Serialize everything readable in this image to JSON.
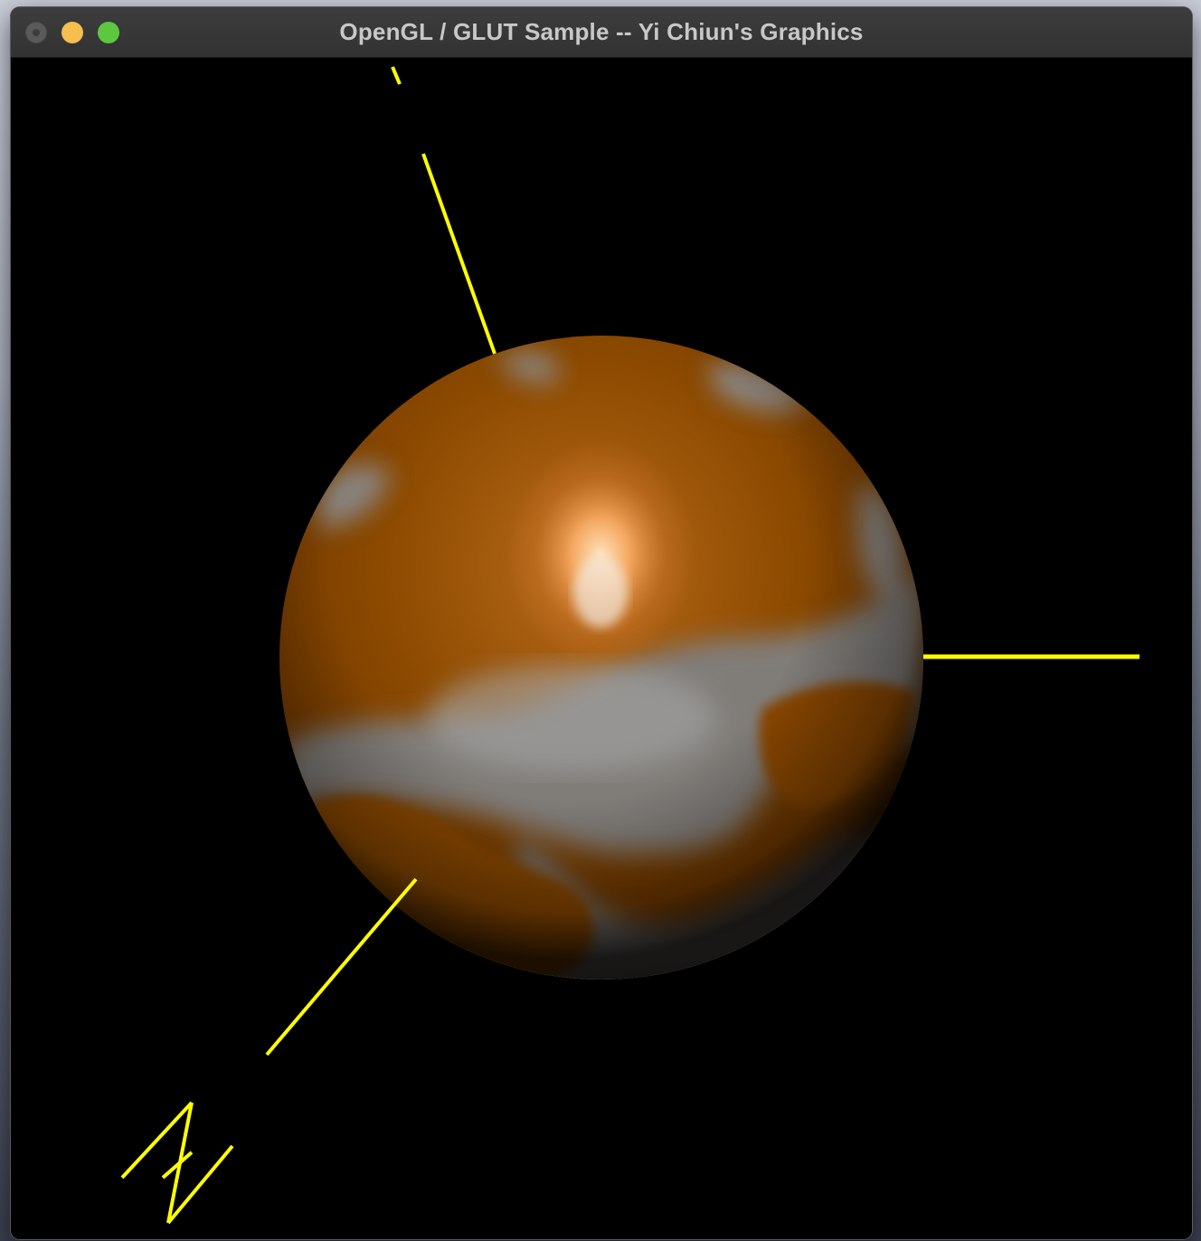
{
  "window": {
    "title": "OpenGL / GLUT Sample -- Yi Chiun's Graphics"
  },
  "controls": {
    "close": "close-icon",
    "minimize": "minimize-icon",
    "zoom": "zoom-icon"
  },
  "scene": {
    "axis_color": "#ffff00",
    "sphere_base_color": "#8c4a00",
    "sphere_highlight_color": "#ffc88a",
    "sphere_secondary_color": "#8a8a8a",
    "axis_letter": "N"
  }
}
